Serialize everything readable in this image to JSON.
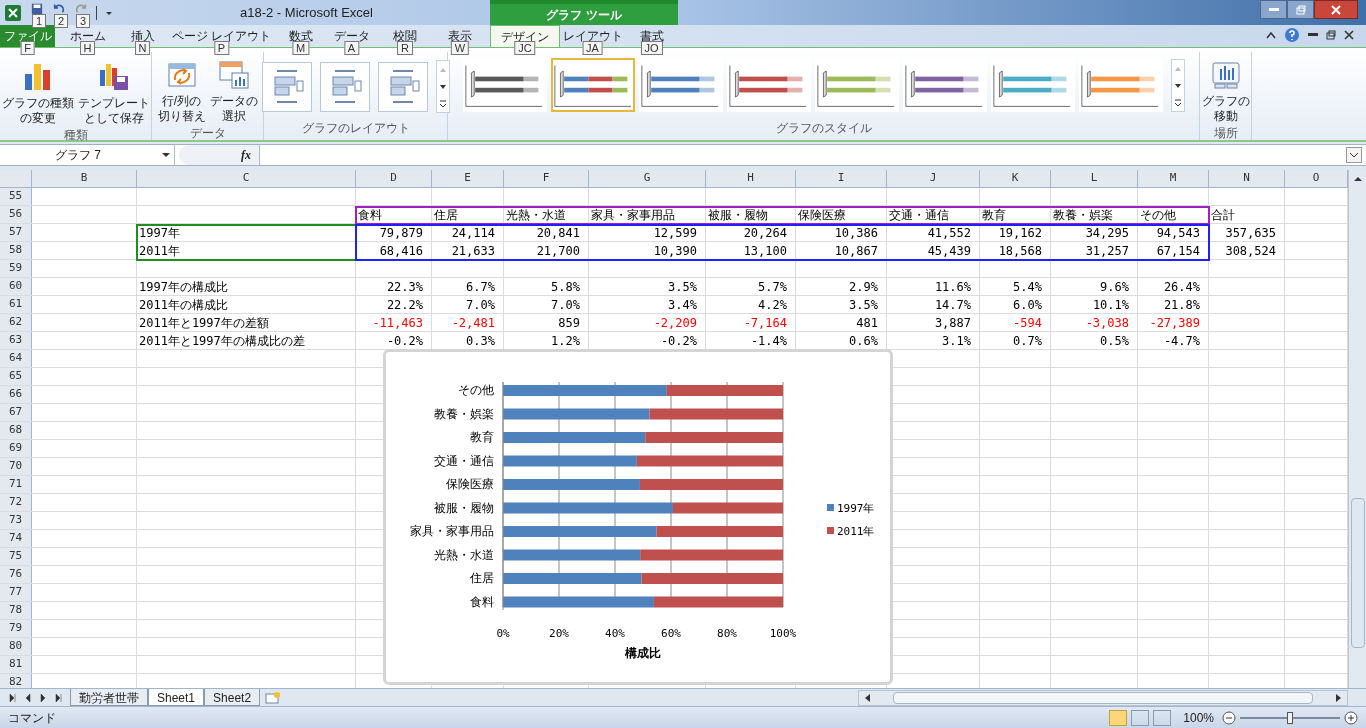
{
  "title_bar": {
    "title": "a18-2  -  Microsoft Excel",
    "quick_access_keytips": [
      "1",
      "2",
      "3"
    ],
    "context_group": "グラフ ツール"
  },
  "tabs": [
    {
      "label": "ファイル",
      "keytip": "F",
      "kind": "file",
      "selected": false
    },
    {
      "label": "ホーム",
      "keytip": "H",
      "kind": "normal",
      "selected": false
    },
    {
      "label": "挿入",
      "keytip": "N",
      "kind": "normal",
      "selected": false
    },
    {
      "label": "ページ レイアウト",
      "keytip": "P",
      "kind": "normal",
      "selected": false
    },
    {
      "label": "数式",
      "keytip": "M",
      "kind": "normal",
      "selected": false
    },
    {
      "label": "データ",
      "keytip": "A",
      "kind": "normal",
      "selected": false
    },
    {
      "label": "校閲",
      "keytip": "R",
      "kind": "normal",
      "selected": false
    },
    {
      "label": "表示",
      "keytip": "W",
      "kind": "normal",
      "selected": false
    },
    {
      "label": "デザイン",
      "keytip": "JC",
      "kind": "context",
      "selected": true
    },
    {
      "label": "レイアウト",
      "keytip": "JA",
      "kind": "context",
      "selected": false
    },
    {
      "label": "書式",
      "keytip": "JO",
      "kind": "context",
      "selected": false
    }
  ],
  "ribbon": {
    "type_group": {
      "label": "種類",
      "buttons": [
        {
          "lines": [
            "グラフの種類",
            "の変更"
          ],
          "kind": "change-type"
        },
        {
          "lines": [
            "テンプレート",
            "として保存"
          ],
          "kind": "save-template"
        }
      ]
    },
    "data_group": {
      "label": "データ",
      "buttons": [
        {
          "lines": [
            "行/列の",
            "切り替え"
          ],
          "kind": "switch"
        },
        {
          "lines": [
            "データの",
            "選択"
          ],
          "kind": "select-data"
        }
      ]
    },
    "layout_group": {
      "label": "グラフのレイアウト"
    },
    "style_group": {
      "label": "グラフのスタイル",
      "styles": [
        {
          "kind": "mono",
          "color": "#595959",
          "selected": false
        },
        {
          "kind": "multi",
          "color": "#4f81bd",
          "selected": true
        },
        {
          "kind": "mono",
          "color": "#4f81bd",
          "selected": false
        },
        {
          "kind": "mono",
          "color": "#c0504d",
          "selected": false
        },
        {
          "kind": "mono",
          "color": "#9bbb59",
          "selected": false
        },
        {
          "kind": "mono",
          "color": "#8064a2",
          "selected": false
        },
        {
          "kind": "mono",
          "color": "#4bacc6",
          "selected": false
        },
        {
          "kind": "mono",
          "color": "#f79646",
          "selected": false
        }
      ]
    },
    "location_group": {
      "label": "場所",
      "buttons": [
        {
          "lines": [
            "グラフの",
            "移動"
          ],
          "kind": "move"
        }
      ]
    }
  },
  "formula_bar": {
    "name_box": "グラフ 7",
    "function_button": "fx"
  },
  "sheet": {
    "columns": [
      "B",
      "C",
      "D",
      "E",
      "F",
      "G",
      "H",
      "I",
      "J",
      "K",
      "L",
      "M",
      "N",
      "O"
    ],
    "rows": [
      {
        "number": "55"
      },
      {
        "number": "56",
        "kind": "header",
        "cells": {
          "D": "食料",
          "E": "住居",
          "F": "光熱・水道",
          "G": "家具・家事用品",
          "H": "被服・履物",
          "I": "保険医療",
          "J": "交通・通信",
          "K": "教育",
          "L": "教養・娯楽",
          "M": "その他",
          "N": "合計"
        }
      },
      {
        "number": "57",
        "kind": "data",
        "cells": {
          "C": "1997年",
          "D": "79,879",
          "E": "24,114",
          "F": "20,841",
          "G": "12,599",
          "H": "20,264",
          "I": "10,386",
          "J": "41,552",
          "K": "19,162",
          "L": "34,295",
          "M": "94,543",
          "N": "357,635"
        }
      },
      {
        "number": "58",
        "kind": "data",
        "cells": {
          "C": "2011年",
          "D": "68,416",
          "E": "21,633",
          "F": "21,700",
          "G": "10,390",
          "H": "13,100",
          "I": "10,867",
          "J": "45,439",
          "K": "18,568",
          "L": "31,257",
          "M": "67,154",
          "N": "308,524"
        }
      },
      {
        "number": "59"
      },
      {
        "number": "60",
        "kind": "data",
        "cells": {
          "C": "1997年の構成比",
          "D": "22.3%",
          "E": "6.7%",
          "F": "5.8%",
          "G": "3.5%",
          "H": "5.7%",
          "I": "2.9%",
          "J": "11.6%",
          "K": "5.4%",
          "L": "9.6%",
          "M": "26.4%"
        }
      },
      {
        "number": "61",
        "kind": "data",
        "cells": {
          "C": "2011年の構成比",
          "D": "22.2%",
          "E": "7.0%",
          "F": "7.0%",
          "G": "3.4%",
          "H": "4.2%",
          "I": "3.5%",
          "J": "14.7%",
          "K": "6.0%",
          "L": "10.1%",
          "M": "21.8%"
        }
      },
      {
        "number": "62",
        "kind": "data",
        "cells": {
          "C": {
            "text": "2011年と1997年の差額",
            "negative": false
          },
          "D": {
            "text": "-11,463",
            "negative": true
          },
          "E": {
            "text": "-2,481",
            "negative": true
          },
          "F": {
            "text": "859",
            "negative": false
          },
          "G": {
            "text": "-2,209",
            "negative": true
          },
          "H": {
            "text": "-7,164",
            "negative": true
          },
          "I": {
            "text": "481",
            "negative": false
          },
          "J": {
            "text": "3,887",
            "negative": false
          },
          "K": {
            "text": "-594",
            "negative": true
          },
          "L": {
            "text": "-3,038",
            "negative": true
          },
          "M": {
            "text": "-27,389",
            "negative": true
          }
        }
      },
      {
        "number": "63",
        "kind": "data",
        "cells": {
          "C": "2011年と1997年の構成比の差",
          "D": "-0.2%",
          "E": "0.3%",
          "F": "1.2%",
          "G": "-0.2%",
          "H": "-1.4%",
          "I": "0.6%",
          "J": "3.1%",
          "K": "0.7%",
          "L": "0.5%",
          "M": "-4.7%"
        }
      },
      {
        "number": "64"
      },
      {
        "number": "65"
      },
      {
        "number": "66"
      },
      {
        "number": "67"
      },
      {
        "number": "68"
      },
      {
        "number": "69"
      },
      {
        "number": "70"
      },
      {
        "number": "71"
      },
      {
        "number": "72"
      },
      {
        "number": "73"
      },
      {
        "number": "74"
      },
      {
        "number": "75"
      },
      {
        "number": "76"
      },
      {
        "number": "77"
      },
      {
        "number": "78"
      },
      {
        "number": "79"
      },
      {
        "number": "80"
      },
      {
        "number": "81"
      },
      {
        "number": "82"
      }
    ],
    "range_highlights": [
      {
        "kind": "categories",
        "color": "#a020c0"
      },
      {
        "kind": "series_names",
        "color": "#228b22"
      },
      {
        "kind": "values",
        "color": "#1f1fff"
      }
    ]
  },
  "chart": {
    "chart_data": {
      "type": "bar",
      "orientation": "horizontal",
      "stacked": true,
      "xlabel": "構成比",
      "categories": [
        "その他",
        "教養・娯楽",
        "教育",
        "交通・通信",
        "保険医療",
        "被服・履物",
        "家具・家事用品",
        "光熱・水道",
        "住居",
        "食料"
      ],
      "series": [
        {
          "name": "1997年",
          "color": "#4f81bd",
          "values": [
            58.5,
            52.3,
            50.8,
            47.8,
            48.9,
            60.7,
            54.8,
            49.0,
            49.5,
            53.9
          ]
        },
        {
          "name": "2011年",
          "color": "#c0504d",
          "values": [
            41.5,
            47.7,
            49.2,
            52.2,
            51.1,
            39.3,
            45.2,
            51.0,
            50.5,
            46.1
          ]
        }
      ],
      "grid": true,
      "legend": true,
      "xlim": [
        0,
        100
      ],
      "xticks": [
        {
          "value": 0,
          "label": "0%"
        },
        {
          "value": 20,
          "label": "20%"
        },
        {
          "value": 40,
          "label": "40%"
        },
        {
          "value": 60,
          "label": "60%"
        },
        {
          "value": 80,
          "label": "80%"
        },
        {
          "value": 100,
          "label": "100%"
        }
      ]
    }
  },
  "sheet_tabs": [
    {
      "label": "勤労者世帯",
      "selected": false
    },
    {
      "label": "Sheet1",
      "selected": true
    },
    {
      "label": "Sheet2",
      "selected": false
    }
  ],
  "status_bar": {
    "mode": "コマンド",
    "zoom": {
      "label": "100%",
      "level": 0.5
    }
  }
}
